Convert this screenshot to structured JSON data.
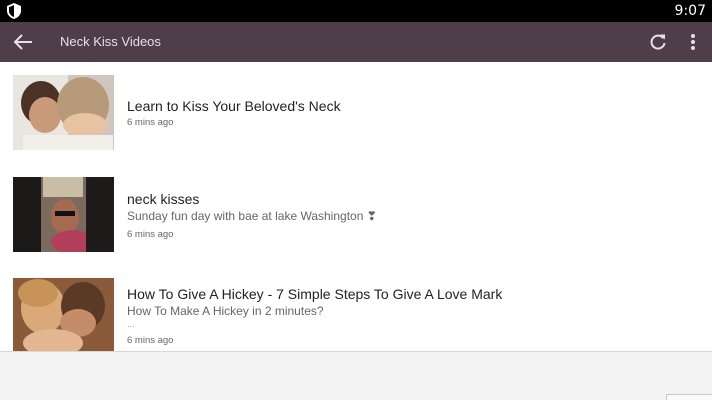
{
  "status_bar": {
    "time": "9:07",
    "shield_icon": "shield-icon"
  },
  "toolbar": {
    "title": "Neck Kiss Videos",
    "back_icon": "arrow-left-icon",
    "refresh_icon": "refresh-icon",
    "menu_icon": "more-vertical-icon",
    "background": "#4d3e49"
  },
  "videos": [
    {
      "title": "Learn to Kiss Your Beloved's Neck",
      "description": "",
      "time": "6 mins ago"
    },
    {
      "title": "neck kisses",
      "description": "Sunday fun day with bae at lake Washington ❣",
      "time": "6 mins ago"
    },
    {
      "title": "How To Give A Hickey - 7 Simple Steps To Give A Love Mark",
      "description": "How To Make A Hickey in 2 minutes?",
      "extra": "...",
      "time": "6 mins ago"
    }
  ]
}
